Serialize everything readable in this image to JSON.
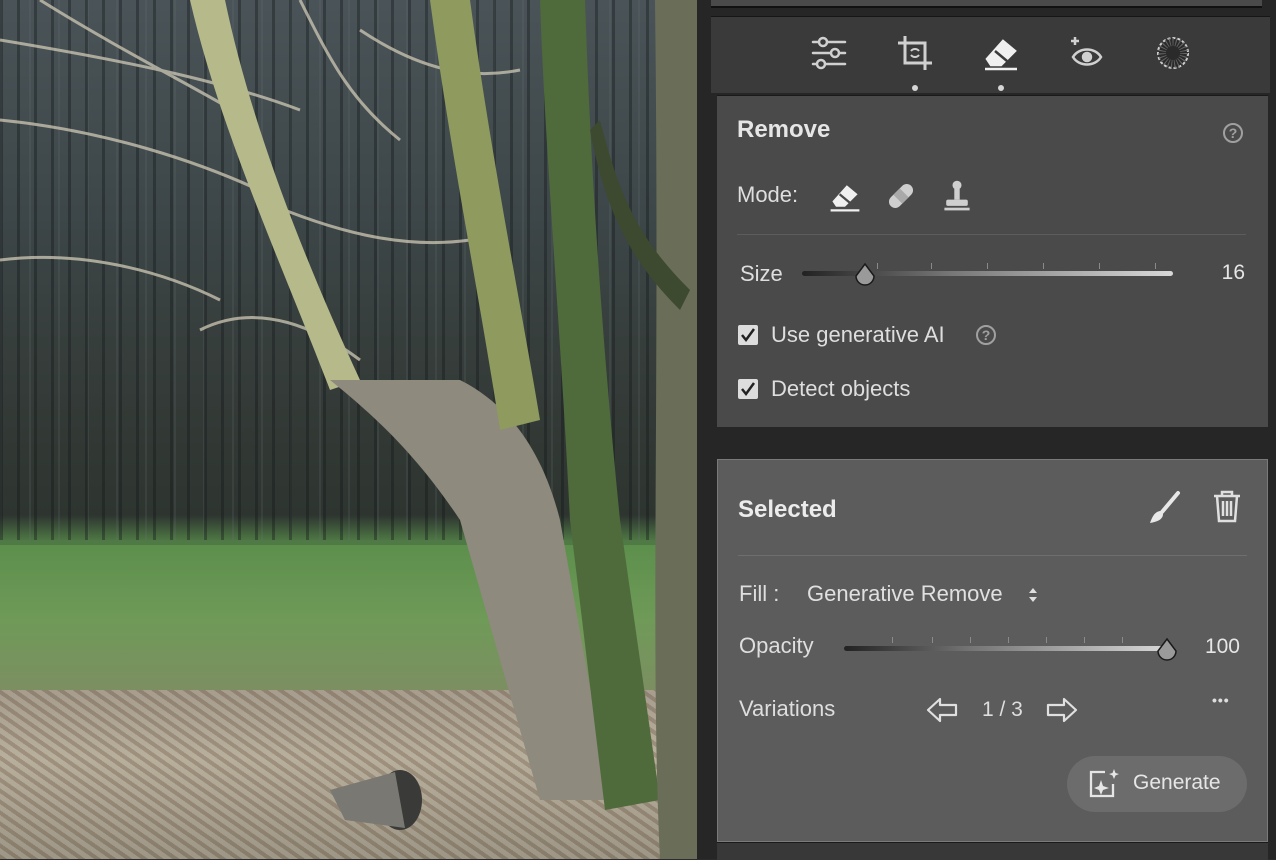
{
  "toolbar": {
    "tools": [
      "edit-sliders-icon",
      "crop-icon",
      "eraser-icon",
      "red-eye-icon",
      "masking-icon"
    ],
    "active_dots": [
      "crop-icon",
      "eraser-icon"
    ]
  },
  "remove": {
    "title": "Remove",
    "help": "?",
    "mode_label": "Mode:",
    "size_label": "Size",
    "size_value": "16",
    "size_fraction": 0.17,
    "use_ai_label": "Use generative AI",
    "use_ai_checked": true,
    "detect_label": "Detect objects",
    "detect_checked": true
  },
  "selected": {
    "title": "Selected",
    "fill_label": "Fill :",
    "fill_value": "Generative Remove",
    "opacity_label": "Opacity",
    "opacity_value": "100",
    "opacity_fraction": 1.0,
    "variations_label": "Variations",
    "variations_value": "1 / 3",
    "more": "•••",
    "generate_label": "Generate"
  }
}
